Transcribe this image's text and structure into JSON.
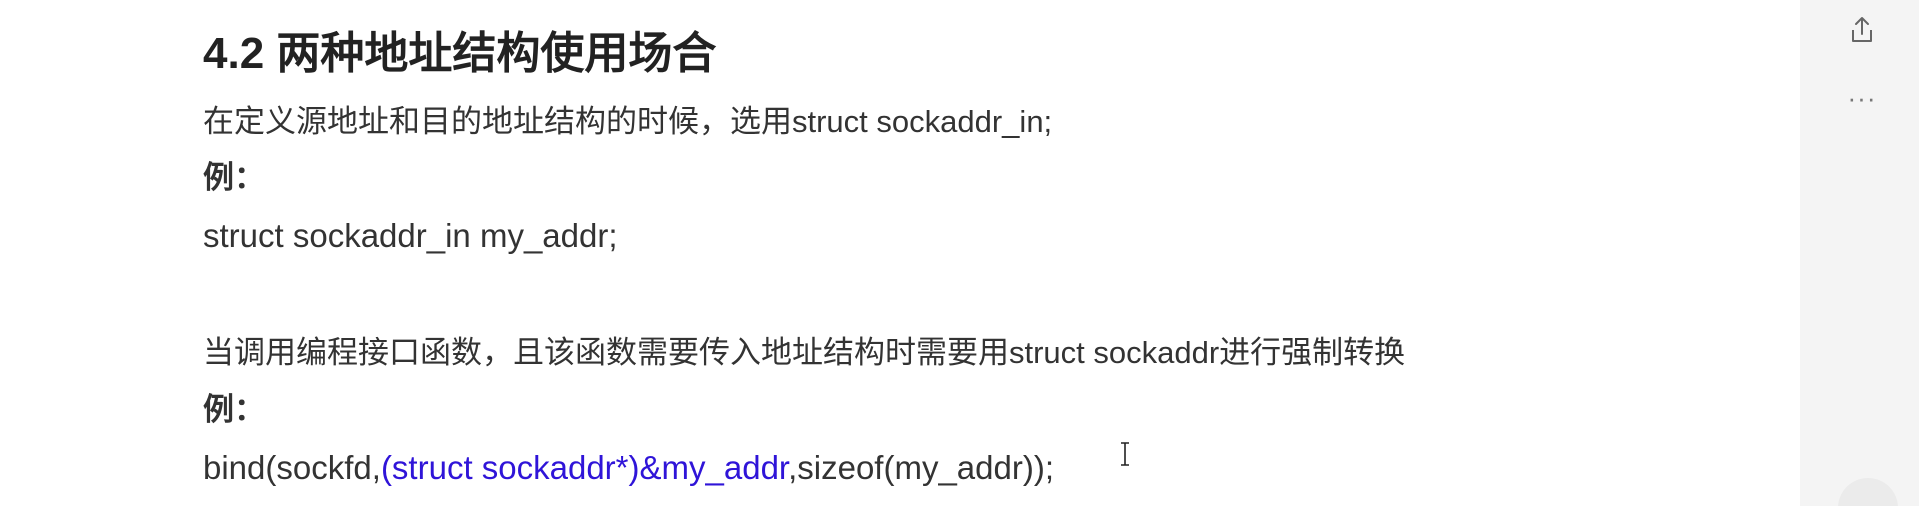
{
  "article": {
    "heading": "4.2 两种地址结构使用场合",
    "p1": "在定义源地址和目的地址结构的时候，选用struct sockaddr_in;",
    "example_label_1": "例：",
    "code1": "struct  sockaddr_in  my_addr;",
    "p2": "当调用编程接口函数，且该函数需要传入地址结构时需要用struct sockaddr进行强制转换",
    "example_label_2": "例：",
    "code2": {
      "prefix": "bind(sockfd,",
      "highlight": "(struct sockaddr*)&my_addr",
      "suffix": ",sizeof(my_addr));"
    }
  },
  "rail": {
    "share_icon": "share-icon",
    "more_label": "···"
  },
  "colors": {
    "highlight": "#2f14d8",
    "text": "#333333",
    "heading": "#222222",
    "panel": "#ffffff",
    "rail": "#f4f4f4"
  }
}
